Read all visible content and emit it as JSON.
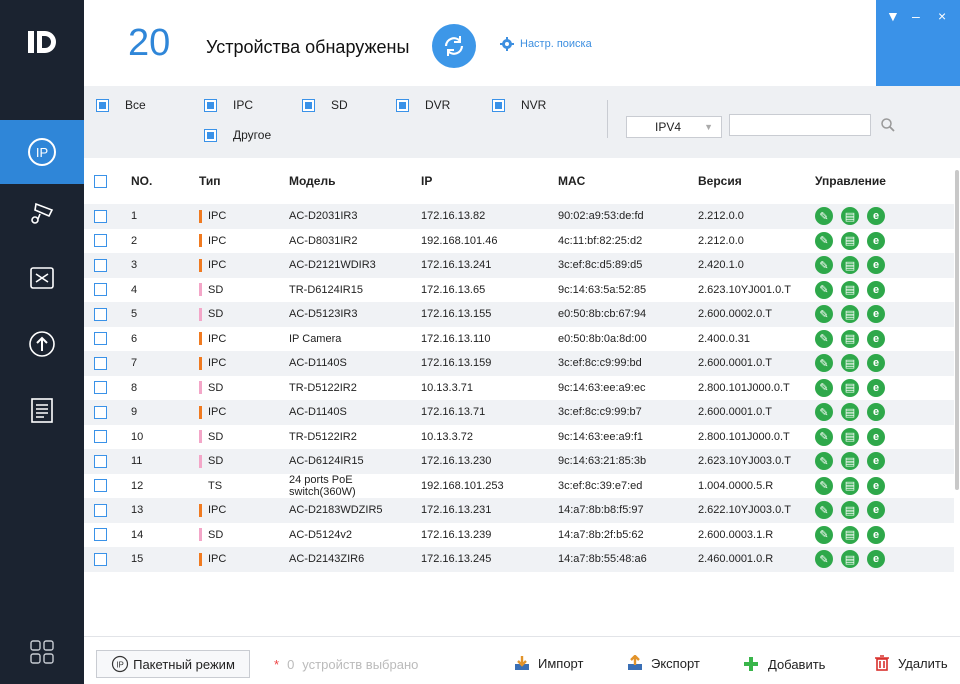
{
  "app": {
    "logo_text": "ID"
  },
  "header": {
    "count": "20",
    "title": "Устройства обнаружены",
    "search_settings_label": "Настр. поиска",
    "window_controls": [
      "▼",
      "–",
      "×"
    ]
  },
  "sidebar": {
    "items": [
      {
        "icon": "ip-search-icon",
        "active": true
      },
      {
        "icon": "camera-settings-icon",
        "active": false
      },
      {
        "icon": "tools-icon",
        "active": false
      },
      {
        "icon": "upgrade-icon",
        "active": false
      },
      {
        "icon": "docs-icon",
        "active": false
      }
    ],
    "bottom_icon": "grid-apps-icon"
  },
  "filters": {
    "options": [
      {
        "label": "Все",
        "checked": true
      },
      {
        "label": "IPC",
        "checked": true
      },
      {
        "label": "SD",
        "checked": true
      },
      {
        "label": "DVR",
        "checked": true
      },
      {
        "label": "NVR",
        "checked": true
      },
      {
        "label": "Другое",
        "checked": true
      }
    ],
    "ip_version": "IPV4",
    "search_value": ""
  },
  "table": {
    "headers": {
      "no": "NO.",
      "type": "Тип",
      "model": "Модель",
      "ip": "IP",
      "mac": "MAC",
      "version": "Версия",
      "control": "Управление"
    },
    "rows": [
      {
        "no": "1",
        "type": "IPC",
        "model": "AC-D2031IR3",
        "ip": "172.16.13.82",
        "mac": "90:02:a9:53:de:fd",
        "version": "2.212.0.0"
      },
      {
        "no": "2",
        "type": "IPC",
        "model": "AC-D8031IR2",
        "ip": "192.168.101.46",
        "mac": "4c:11:bf:82:25:d2",
        "version": "2.212.0.0"
      },
      {
        "no": "3",
        "type": "IPC",
        "model": "AC-D2121WDIR3",
        "ip": "172.16.13.241",
        "mac": "3c:ef:8c:d5:89:d5",
        "version": "2.420.1.0"
      },
      {
        "no": "4",
        "type": "SD",
        "model": "TR-D6124IR15",
        "ip": "172.16.13.65",
        "mac": "9c:14:63:5a:52:85",
        "version": "2.623.10YJ001.0.T"
      },
      {
        "no": "5",
        "type": "SD",
        "model": "AC-D5123IR3",
        "ip": "172.16.13.155",
        "mac": "e0:50:8b:cb:67:94",
        "version": "2.600.0002.0.T"
      },
      {
        "no": "6",
        "type": "IPC",
        "model": "IP Camera",
        "ip": "172.16.13.110",
        "mac": "e0:50:8b:0a:8d:00",
        "version": "2.400.0.31"
      },
      {
        "no": "7",
        "type": "IPC",
        "model": "AC-D1140S",
        "ip": "172.16.13.159",
        "mac": "3c:ef:8c:c9:99:bd",
        "version": "2.600.0001.0.T"
      },
      {
        "no": "8",
        "type": "SD",
        "model": "TR-D5122IR2",
        "ip": "10.13.3.71",
        "mac": "9c:14:63:ee:a9:ec",
        "version": "2.800.101J000.0.T"
      },
      {
        "no": "9",
        "type": "IPC",
        "model": "AC-D1140S",
        "ip": "172.16.13.71",
        "mac": "3c:ef:8c:c9:99:b7",
        "version": "2.600.0001.0.T"
      },
      {
        "no": "10",
        "type": "SD",
        "model": "TR-D5122IR2",
        "ip": "10.13.3.72",
        "mac": "9c:14:63:ee:a9:f1",
        "version": "2.800.101J000.0.T"
      },
      {
        "no": "11",
        "type": "SD",
        "model": "AC-D6124IR15",
        "ip": "172.16.13.230",
        "mac": "9c:14:63:21:85:3b",
        "version": "2.623.10YJ003.0.T"
      },
      {
        "no": "12",
        "type": "TS",
        "model": "24 ports PoE",
        "model2": "switch(360W)",
        "ip": "192.168.101.253",
        "mac": "3c:ef:8c:39:e7:ed",
        "version": "1.004.0000.5.R"
      },
      {
        "no": "13",
        "type": "IPC",
        "model": "AC-D2183WDZIR5",
        "ip": "172.16.13.231",
        "mac": "14:a7:8b:b8:f5:97",
        "version": "2.622.10YJ003.0.T"
      },
      {
        "no": "14",
        "type": "SD",
        "model": "AC-D5124v2",
        "ip": "172.16.13.239",
        "mac": "14:a7:8b:2f:b5:62",
        "version": "2.600.0003.1.R"
      },
      {
        "no": "15",
        "type": "IPC",
        "model": "AC-D2143ZIR6",
        "ip": "172.16.13.245",
        "mac": "14:a7:8b:55:48:a6",
        "version": "2.460.0001.0.R"
      }
    ],
    "type_colors": {
      "IPC": "#f07a20",
      "SD": "#f3a6c8",
      "TS": "transparent"
    }
  },
  "footer": {
    "batch_label": "Пакетный режим",
    "selected_count": "0",
    "selected_text": "устройств выбрано",
    "import_label": "Импорт",
    "export_label": "Экспорт",
    "add_label": "Добавить",
    "delete_label": "Удалить"
  },
  "colors": {
    "accent": "#3a92e8",
    "sidebar": "#1b2330",
    "action_green": "#2ea84a",
    "delete_red": "#d9302c"
  }
}
